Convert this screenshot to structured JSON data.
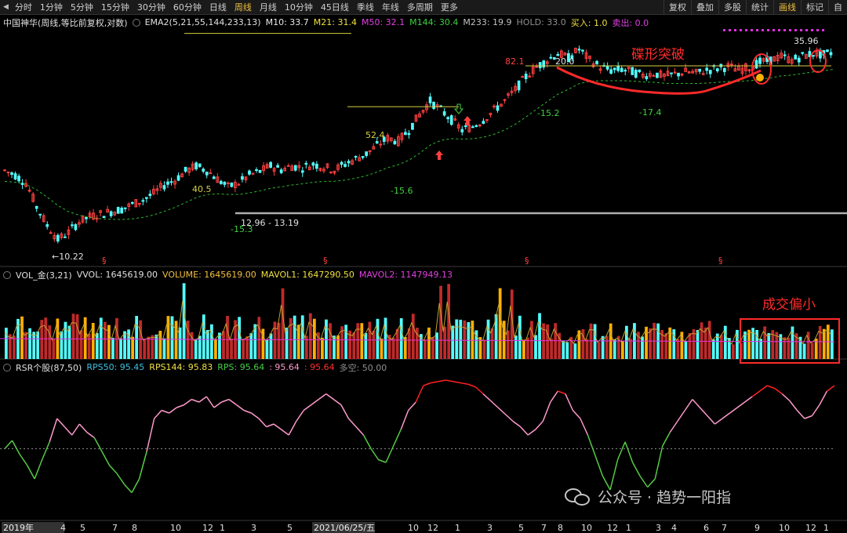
{
  "toolbar": {
    "tabs": [
      "分时",
      "1分钟",
      "5分钟",
      "15分钟",
      "30分钟",
      "60分钟",
      "日线",
      "周线",
      "月线",
      "10分钟",
      "45日线",
      "季线",
      "年线",
      "多周期",
      "更多"
    ],
    "active_tab": "周线",
    "right_buttons": [
      "复权",
      "叠加",
      "多股",
      "统计",
      "画线",
      "标记",
      "自"
    ],
    "active_right": "画线"
  },
  "main_legend": {
    "title": "中国神华(周线,等比前复权,对数)",
    "ema_name": "EMA2(5,21,55,144,233,13)",
    "m10": "M10: 33.7",
    "m21": "M21: 31.4",
    "m50": "M50: 32.1",
    "m144": "M144: 30.4",
    "m233": "M233: 19.9",
    "hold": "HOLD: 33.0",
    "buy": "买入: 1.0",
    "sell": "卖出: 0.0"
  },
  "vol_legend": {
    "name": "VOL_金(3,21)",
    "vvol": "VVOL: 1645619.00",
    "volume": "VOLUME: 1645619.00",
    "mavol1": "MAVOL1: 1647290.50",
    "mavol2": "MAVOL2: 1147949.13"
  },
  "rsr_legend": {
    "name": "RSR个股(87,50)",
    "rps50": "RPS50: 95.45",
    "rps144": "RPS144: 95.83",
    "rps": "RPS: 95.64",
    "v1": ": 95.64",
    "v2": ": 95.64",
    "duokong": "多空: 50.00"
  },
  "colors": {
    "up": "#ff4040",
    "down": "#54ffff",
    "gold": "#ffb000",
    "ema": "#2fb82f",
    "level": "#d8d040",
    "annot": "#ff2a2a",
    "rsr_low": "#55cc44",
    "rsr_mid": "#ff99cc",
    "rsr_high": "#ff2020",
    "magenta": "#e030e0"
  },
  "annotations": {
    "cup_label": "碟形突破",
    "low_vol_label": "成交偏小",
    "price_labels": [
      "10.22",
      "40.5",
      "-15.3",
      "12.96 - 13.19",
      "52.4",
      "-15.6",
      "82.1",
      "-15.2",
      "20.0",
      "-17.4",
      "35.96"
    ]
  },
  "chart_data": [
    {
      "type": "candlestick",
      "title": "中国神华(周线,等比前复权,对数)",
      "scale": "log",
      "x_ticks": [
        "2019年",
        "4",
        "5",
        "7",
        "8",
        "10",
        "12",
        "1",
        "3",
        "5",
        "2021/06/25/五",
        "10",
        "12",
        "1",
        "3",
        "5",
        "7",
        "8",
        "10",
        "12",
        "1",
        "3",
        "4",
        "6",
        "7",
        "9",
        "10",
        "12",
        "1"
      ],
      "key_points": {
        "low_2019": 10.22,
        "level_1": 40.5,
        "level_2": 52.4,
        "peak": 82.1,
        "latest_high": 35.96,
        "support_band": [
          12.96,
          13.19
        ]
      },
      "approx_close_path": [
        16.5,
        16.0,
        15.2,
        13.0,
        11.5,
        10.5,
        11.0,
        11.8,
        12.2,
        12.4,
        12.6,
        12.8,
        13.2,
        13.6,
        14.2,
        15.0,
        15.5,
        16.4,
        17.0,
        16.5,
        15.6,
        14.8,
        15.2,
        16.0,
        16.4,
        17.0,
        16.6,
        17.0,
        16.8,
        17.2,
        16.9,
        16.6,
        17.2,
        17.8,
        18.4,
        19.4,
        20.4,
        20.0,
        21.5,
        23.8,
        26.0,
        24.5,
        23.0,
        21.5,
        22.0,
        23.0,
        24.5,
        26.0,
        28.0,
        30.5,
        32.5,
        34.0,
        35.5,
        34.5,
        36.5,
        34.0,
        32.5,
        31.8,
        32.0,
        31.5,
        30.8,
        31.2,
        30.6,
        31.0,
        31.5,
        31.2,
        31.8,
        32.2,
        32.6,
        31.9,
        32.5,
        33.5,
        34.0,
        34.8,
        34.0,
        34.9,
        35.5,
        35.2,
        35.96
      ]
    },
    {
      "type": "bar",
      "title": "VOL_金(3,21)",
      "series": [
        {
          "name": "VOLUME",
          "last": 1645619.0
        },
        {
          "name": "MAVOL1",
          "last": 1647290.5
        },
        {
          "name": "MAVOL2",
          "last": 1147949.13
        }
      ]
    },
    {
      "type": "line",
      "title": "RSR个股(87,50)",
      "ylim": [
        0,
        100
      ],
      "midline": 50,
      "approx_values": [
        50,
        56,
        46,
        38,
        28,
        42,
        55,
        72,
        66,
        60,
        68,
        62,
        58,
        48,
        38,
        32,
        24,
        18,
        28,
        48,
        72,
        78,
        76,
        80,
        82,
        86,
        84,
        88,
        80,
        84,
        86,
        82,
        78,
        76,
        72,
        66,
        68,
        64,
        60,
        70,
        78,
        82,
        86,
        90,
        86,
        82,
        72,
        66,
        60,
        50,
        42,
        40,
        52,
        64,
        78,
        84,
        96,
        98,
        99,
        100,
        99,
        98,
        97,
        95,
        90,
        85,
        80,
        75,
        70,
        66,
        60,
        64,
        70,
        84,
        92,
        90,
        78,
        72,
        60,
        45,
        30,
        20,
        42,
        55,
        40,
        30,
        22,
        28,
        52,
        62,
        70,
        78,
        86,
        80,
        74,
        68,
        72,
        76,
        80,
        84,
        88,
        92,
        96,
        94,
        90,
        85,
        78,
        72,
        74,
        82,
        92,
        96
      ]
    }
  ]
}
